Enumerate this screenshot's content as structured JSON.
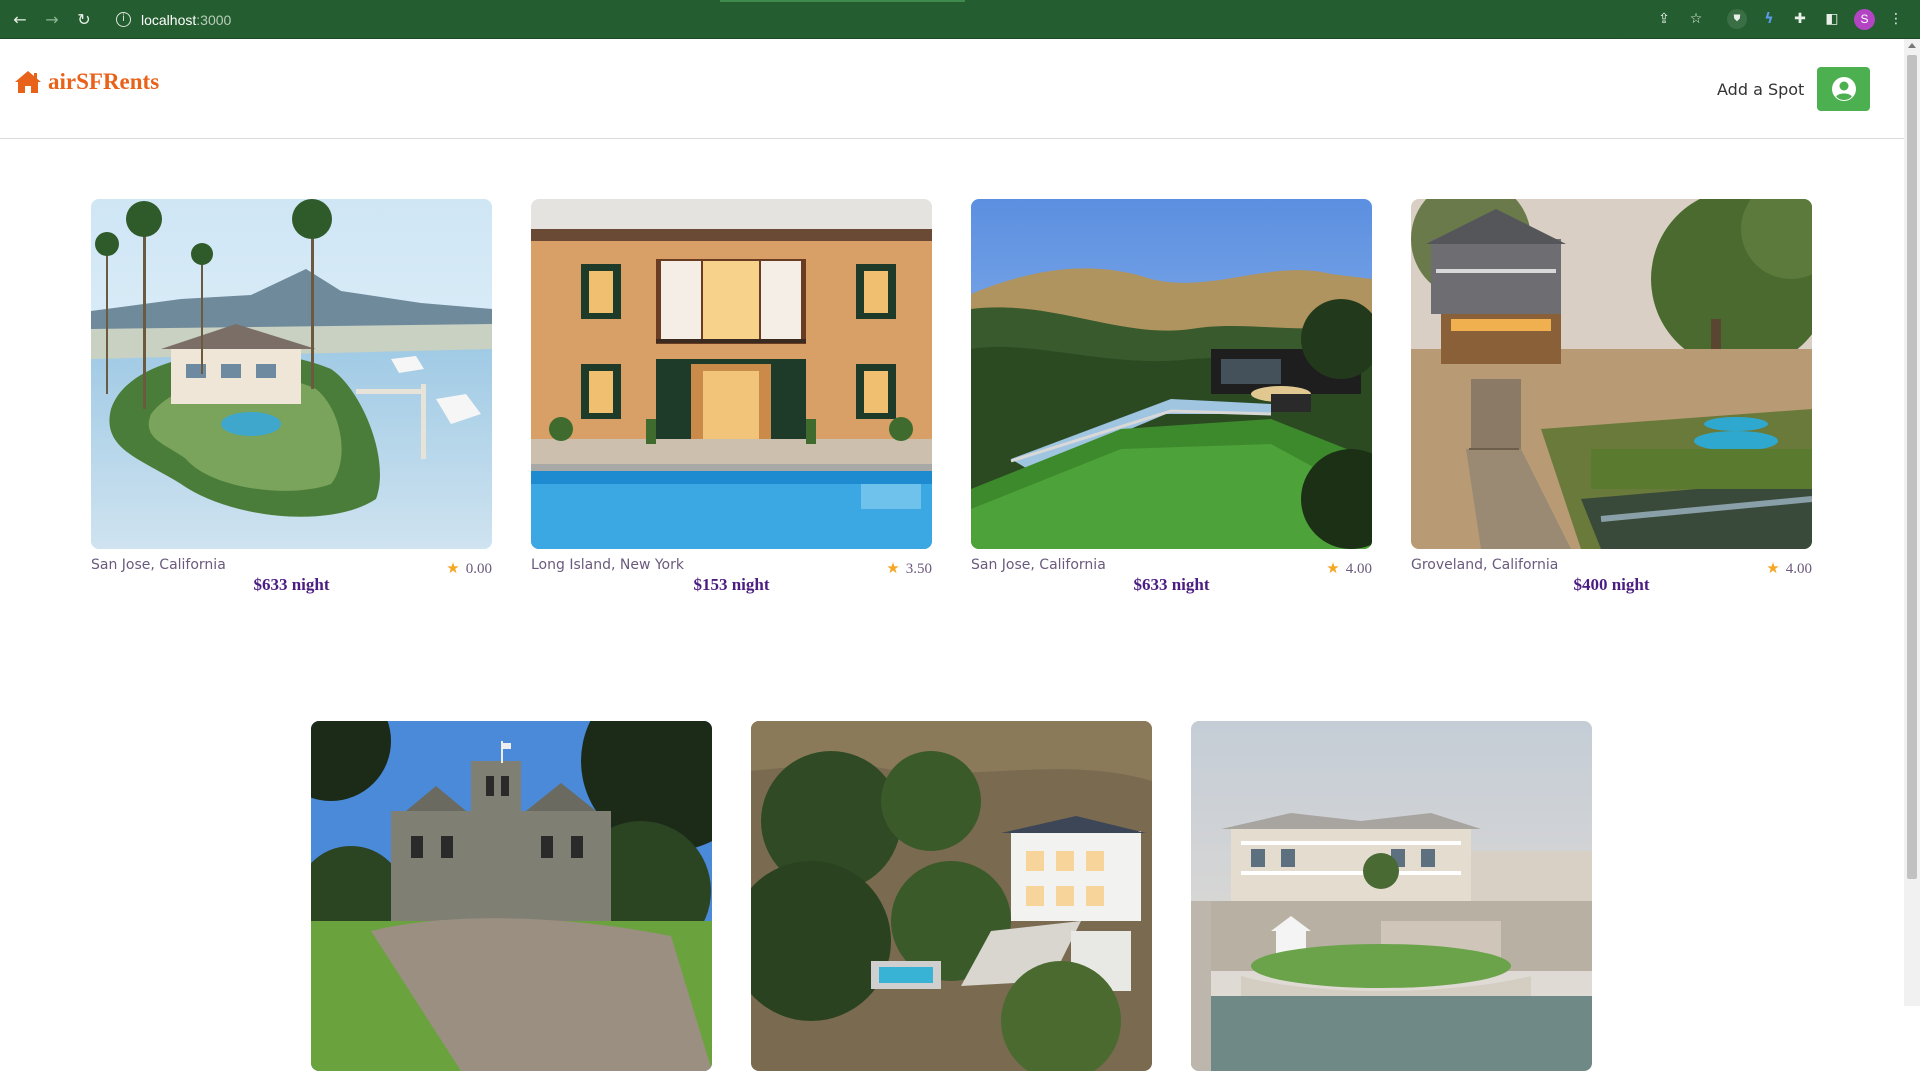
{
  "browser": {
    "url_host": "localhost",
    "url_port": ":3000"
  },
  "header": {
    "brand": "airSFRents",
    "add_spot_label": "Add a Spot",
    "brand_color": "#e8621a",
    "button_color": "#4caf50"
  },
  "spots": [
    {
      "location": "San Jose, California",
      "rating": "0.00",
      "price": "$633 night"
    },
    {
      "location": "Long Island, New York",
      "rating": "3.50",
      "price": "$153 night"
    },
    {
      "location": "San Jose, California",
      "rating": "4.00",
      "price": "$633 night"
    },
    {
      "location": "Groveland, California",
      "rating": "4.00",
      "price": "$400 night"
    },
    {
      "location": "",
      "rating": "",
      "price": ""
    },
    {
      "location": "",
      "rating": "",
      "price": ""
    },
    {
      "location": "",
      "rating": "",
      "price": ""
    }
  ]
}
